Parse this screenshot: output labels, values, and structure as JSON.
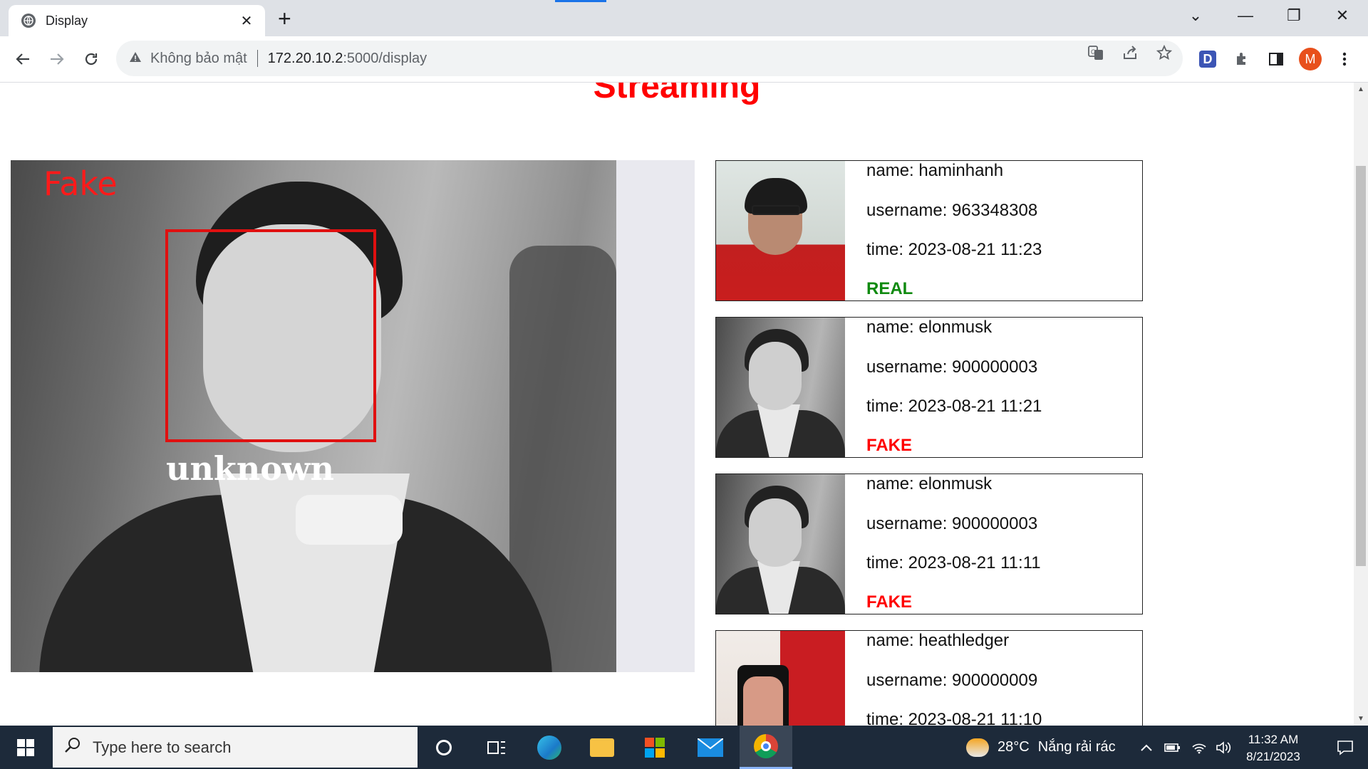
{
  "browser": {
    "tab_title": "Display",
    "tab_close": "✕",
    "new_tab": "+",
    "insecure_label": "Không bảo mật",
    "url_host": "172.20.10.2",
    "url_path": ":5000/display",
    "window_controls": {
      "dropdown": "⌄",
      "minimize": "—",
      "restore": "❐",
      "close": "✕"
    }
  },
  "page": {
    "heading": "Streaming",
    "video": {
      "spoof_label": "Fake",
      "identity_label": "unknown"
    },
    "logs": [
      {
        "name": "name: haminhanh",
        "username": "username: 963348308",
        "time": "time: 2023-08-21 11:23",
        "status": "REAL",
        "status_color": "#108a10"
      },
      {
        "name": "name: elonmusk",
        "username": "username: 900000003",
        "time": "time: 2023-08-21 11:21",
        "status": "FAKE",
        "status_color": "#ff0000"
      },
      {
        "name": "name: elonmusk",
        "username": "username: 900000003",
        "time": "time: 2023-08-21 11:11",
        "status": "FAKE",
        "status_color": "#ff0000"
      },
      {
        "name": "name: heathledger",
        "username": "username: 900000009",
        "time": "time: 2023-08-21 11:10",
        "status": "",
        "status_color": "#ff0000"
      }
    ]
  },
  "taskbar": {
    "search_placeholder": "Type here to search",
    "weather_temp": "28°C",
    "weather_text": "Nắng rải rác",
    "time": "11:32 AM",
    "date": "8/21/2023"
  }
}
